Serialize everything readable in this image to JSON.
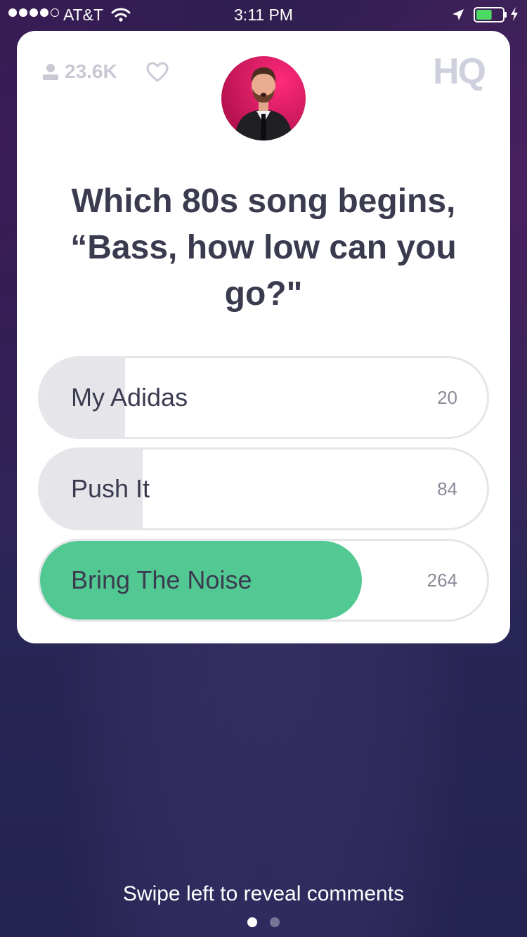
{
  "status_bar": {
    "carrier": "AT&T",
    "time": "3:11 PM",
    "signal_bars_filled": 4,
    "signal_bars_total": 5,
    "battery_level": 0.6,
    "charging": true
  },
  "header": {
    "viewer_count": "23.6K",
    "logo": "HQ",
    "viewer_icon": "person-icon",
    "like_icon": "heart-outline-icon"
  },
  "host": {
    "avatar_icon": "host-avatar"
  },
  "question": {
    "text": "Which 80s song begins, “Bass, how low can you go?\""
  },
  "answers": [
    {
      "label": "My Adidas",
      "count": "20",
      "fill": 0.19,
      "correct": false
    },
    {
      "label": "Push It",
      "count": "84",
      "fill": 0.23,
      "correct": false
    },
    {
      "label": "Bring The Noise",
      "count": "264",
      "fill": 0.72,
      "correct": true
    }
  ],
  "footer": {
    "hint": "Swipe left to reveal comments",
    "page_index": 0,
    "page_count": 2
  },
  "colors": {
    "correct_answer": "#52c993",
    "answer_fill": "#e6e6ea",
    "question_text": "#3a3b4f",
    "logo": "#cfd0dd",
    "avatar_background": "#e0186a"
  }
}
